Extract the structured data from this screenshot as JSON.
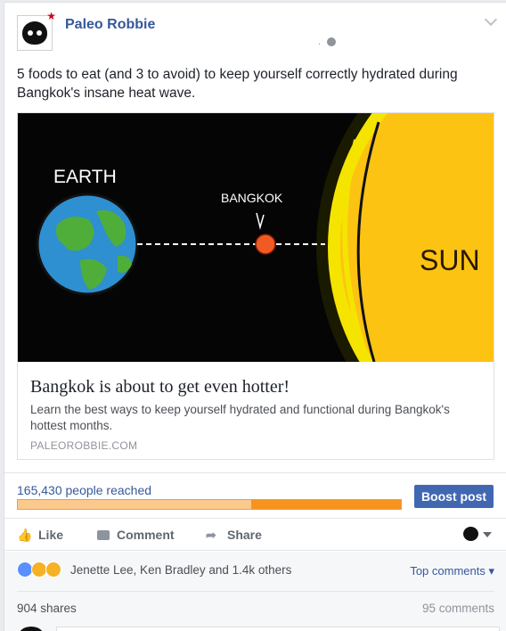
{
  "post": {
    "author": "Paleo Robbie",
    "meta_dot": ".",
    "text": "5 foods to eat (and 3 to avoid) to keep yourself correctly hydrated during Bangkok's insane heat wave."
  },
  "link_preview": {
    "image_labels": {
      "earth": "EARTH",
      "bangkok": "BANGKOK",
      "sun": "SUN"
    },
    "title": "Bangkok is about to get even hotter!",
    "description": "Learn the best ways to keep yourself hydrated and functional during Bangkok's hottest months.",
    "domain": "PALEOROBBIE.COM"
  },
  "insights": {
    "reach_text": "165,430 people reached",
    "reach_fill_fraction": 0.61,
    "boost_label": "Boost post"
  },
  "actions": {
    "like": "Like",
    "comment": "Comment",
    "share": "Share"
  },
  "reactions": {
    "icons": [
      "like-icon",
      "haha-icon",
      "wow-icon"
    ],
    "summary": "Jenette Lee, Ken Bradley and 1.4k others",
    "top_comments": "Top comments"
  },
  "stats": {
    "shares": "904 shares",
    "comments": "95 comments"
  },
  "colors": {
    "link_blue": "#365899",
    "boost_blue": "#4267b2",
    "bar_light": "#fbc98c",
    "bar_dark": "#f7931e",
    "sun_yellow": "#fcc313",
    "bangkok_orange": "#f05a23"
  }
}
